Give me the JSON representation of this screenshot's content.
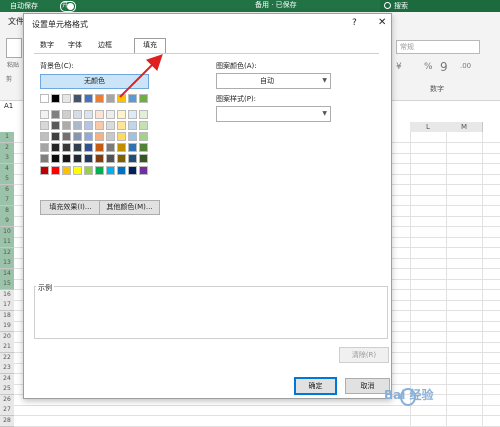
{
  "titlebar": {
    "autosave": "自动保存",
    "toggle": "开",
    "doc_title": "备用 · 已保存",
    "search": "搜索"
  },
  "ribbon": {
    "file_tab": "文件",
    "paste_label": "粘贴",
    "clipboard_label": "剪",
    "number_format_value": "常规",
    "number_group_label": "数字",
    "currency_symbol": "¥",
    "percent_symbol": "%",
    "comma_symbol": "9",
    "decimal_symbol": ".00"
  },
  "namebox": "A1",
  "grid": {
    "columns": [
      "L",
      "M"
    ],
    "rows": [
      "1",
      "2",
      "3",
      "4",
      "5",
      "6",
      "7",
      "8",
      "9",
      "10",
      "11",
      "12",
      "13",
      "14",
      "15",
      "16",
      "17",
      "18",
      "19",
      "20",
      "21",
      "22",
      "23",
      "24",
      "25",
      "26",
      "27",
      "28"
    ]
  },
  "dialog": {
    "title": "设置单元格格式",
    "help": "?",
    "close": "✕",
    "tabs": [
      {
        "label": "数字"
      },
      {
        "label": "字体"
      },
      {
        "label": "边框"
      },
      {
        "label": "填充",
        "active": true
      }
    ],
    "background_color_label": "背景色(C):",
    "no_color_button": "无颜色",
    "fill_effects_button": "填充效果(I)...",
    "more_colors_button": "其他颜色(M)...",
    "pattern_color_label": "图案颜色(A):",
    "pattern_color_value": "自动",
    "pattern_style_label": "图案样式(P):",
    "sample_label": "示例",
    "clear_button": "清除(R)",
    "ok_button": "确定",
    "cancel_button": "取消",
    "palette": {
      "theme_row": [
        "#ffffff",
        "#000000",
        "#e7e6e6",
        "#44546a",
        "#4472c4",
        "#ed7d31",
        "#a5a5a5",
        "#ffc000",
        "#5b9bd5",
        "#70ad47"
      ],
      "tints": [
        [
          "#f2f2f2",
          "#808080",
          "#d0cece",
          "#d6dce4",
          "#d9e2f3",
          "#fbe4d5",
          "#ededed",
          "#fff2cc",
          "#deebf6",
          "#e2efd9"
        ],
        [
          "#d8d8d8",
          "#595959",
          "#aeabab",
          "#adb9ca",
          "#b4c6e7",
          "#f7caac",
          "#dbdbdb",
          "#fee599",
          "#bdd7ee",
          "#c5e0b3"
        ],
        [
          "#bfbfbf",
          "#3f3f3f",
          "#757070",
          "#8496b0",
          "#8eaadb",
          "#f4b183",
          "#c9c9c9",
          "#ffd965",
          "#9cc3e5",
          "#a8d08d"
        ],
        [
          "#a5a5a5",
          "#262626",
          "#3a3838",
          "#323f4f",
          "#2f5496",
          "#c55a11",
          "#7b7b7b",
          "#bf8f00",
          "#2e75b5",
          "#538135"
        ],
        [
          "#7f7f7f",
          "#0c0c0c",
          "#171616",
          "#222a35",
          "#1f3864",
          "#833c0b",
          "#525252",
          "#7f6000",
          "#1f4e79",
          "#375623"
        ]
      ],
      "standard_row": [
        "#c00000",
        "#ff0000",
        "#ffc000",
        "#ffff00",
        "#92d050",
        "#00b050",
        "#00b0f0",
        "#0070c0",
        "#002060",
        "#7030a0"
      ]
    }
  },
  "watermark": "Bai 经验",
  "colors": {
    "excel_green": "#217346",
    "accent_blue": "#0078d7",
    "arrow_red": "#e02020"
  }
}
